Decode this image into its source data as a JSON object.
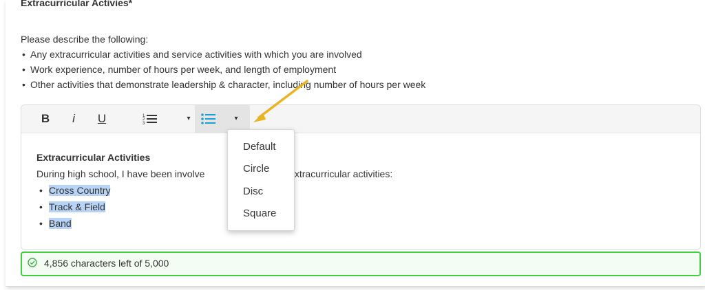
{
  "section": {
    "title": "Extracurricular Activies*",
    "intro": "Please describe the following:",
    "bullets": [
      "Any extracurricular activities and service activities with which you are involved",
      "Work experience, number of hours per week, and length of employment",
      "Other activities that demonstrate leadership & character, including number of hours per week"
    ]
  },
  "toolbar": {
    "bold": "B",
    "italic": "i",
    "underline": "U",
    "ordered_list_icon": "numbered-list-icon",
    "bullet_list_icon": "bulleted-list-icon",
    "caret": "▾"
  },
  "editor": {
    "heading": "Extracurricular Activities",
    "sentence_start": "During high school, I have been involve",
    "sentence_end": "wing extracurricular activities:",
    "items": [
      "Cross Country",
      "Track & Field",
      "Band"
    ]
  },
  "list_style_menu": {
    "options": [
      "Default",
      "Circle",
      "Disc",
      "Square"
    ]
  },
  "counter": {
    "text": "4,856 characters left of 5,000"
  },
  "colors": {
    "accent_green": "#3fd03f",
    "selection_highlight": "#b7d3f5",
    "bullet_icon_blue": "#1a9fd6",
    "arrow": "#e8b423"
  }
}
